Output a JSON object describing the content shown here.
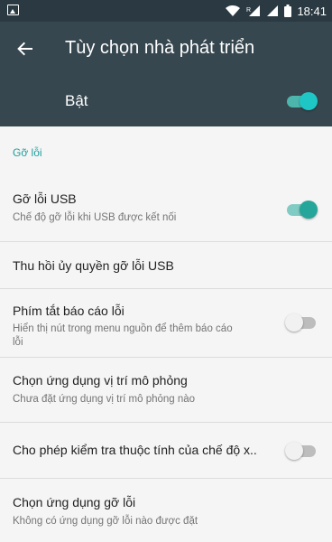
{
  "status_bar": {
    "time": "18:41",
    "icons": [
      "image-icon",
      "wifi-icon",
      "signal-icon",
      "signal-icon",
      "battery-icon"
    ]
  },
  "app_bar": {
    "title": "Tùy chọn nhà phát triển",
    "back_icon": "arrow-back-icon"
  },
  "master_switch": {
    "label": "Bật",
    "on": true
  },
  "section": {
    "header": "Gỡ lỗi"
  },
  "items": [
    {
      "title": "Gỡ lỗi USB",
      "summary": "Chế độ gỡ lỗi khi USB được kết nối",
      "switch": "on"
    },
    {
      "title": "Thu hồi ủy quyền gỡ lỗi USB",
      "summary": "",
      "switch": ""
    },
    {
      "title": "Phím tắt báo cáo lỗi",
      "summary_line1": "Hiển thị nút trong menu nguồn để thêm báo cáo",
      "summary_line2": "lỗi",
      "switch": "off"
    },
    {
      "title": "Chọn ứng dụng vị trí mô phỏng",
      "summary": "Chưa đặt ứng dụng vị trí mô phỏng nào",
      "switch": ""
    },
    {
      "title": "Cho phép kiểm tra thuộc tính của chế độ x..",
      "summary": "",
      "switch": "off"
    },
    {
      "title": "Chọn ứng dụng gỡ lỗi",
      "summary": "Không có ứng dụng gỡ lỗi nào được đặt",
      "switch": ""
    }
  ],
  "colors": {
    "app_bar": "#37474f",
    "status_bar": "#2b3a42",
    "accent": "#26a69a",
    "section_header": "#1e9e9e"
  }
}
